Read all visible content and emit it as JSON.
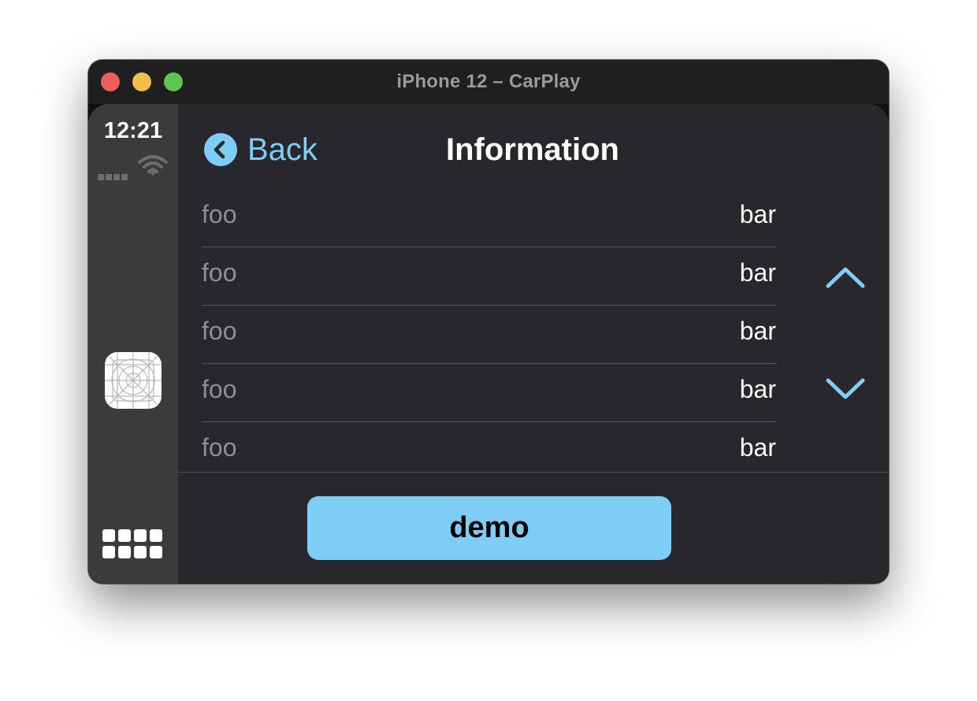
{
  "window": {
    "title": "iPhone 12 – CarPlay"
  },
  "status": {
    "time": "12:21"
  },
  "nav": {
    "back_label": "Back",
    "title": "Information"
  },
  "list": {
    "rows": [
      {
        "key": "foo",
        "value": "bar"
      },
      {
        "key": "foo",
        "value": "bar"
      },
      {
        "key": "foo",
        "value": "bar"
      },
      {
        "key": "foo",
        "value": "bar"
      },
      {
        "key": "foo",
        "value": "bar"
      }
    ]
  },
  "actions": {
    "demo_label": "demo"
  },
  "icons": {
    "back": "chevron-left-circle-icon",
    "scroll_up": "chevron-up-icon",
    "scroll_down": "chevron-down-icon",
    "wifi": "wifi-icon",
    "app": "app-placeholder-icon",
    "dashboard": "dashboard-grid-icon"
  },
  "colors": {
    "accent": "#7ecdf6",
    "background": "#28282c",
    "sidebar": "#3b3b3e"
  }
}
